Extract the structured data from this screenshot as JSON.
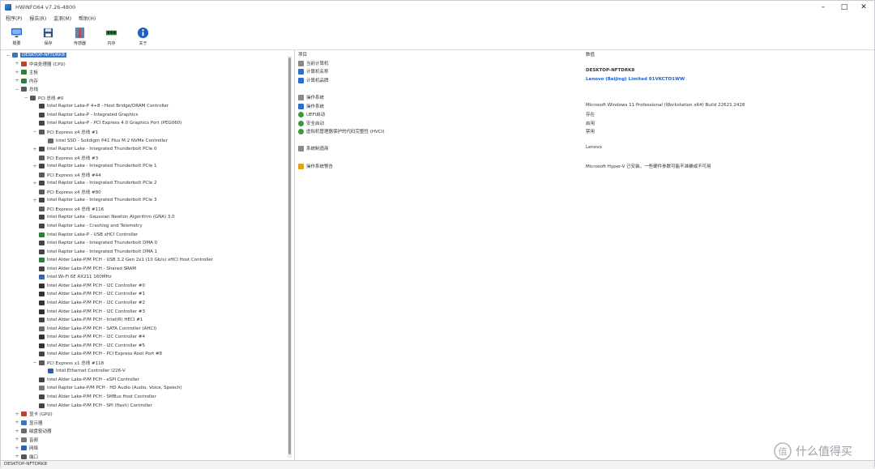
{
  "window": {
    "title": "HWiNFO64 v7.26-4800"
  },
  "menu": {
    "items": [
      "程序(P)",
      "报告(R)",
      "监测(M)",
      "帮助(H)"
    ]
  },
  "toolbar": {
    "buttons": [
      "概要",
      "保存",
      "传感器",
      "内存",
      "关于"
    ]
  },
  "tree": {
    "items": [
      {
        "label": "DESKTOP-NFTDRK8",
        "depth": 0,
        "exp": "−",
        "icon": "computer",
        "selected": true
      },
      {
        "label": "中央处理器 (CPU)",
        "depth": 1,
        "exp": "+",
        "icon": "cpu"
      },
      {
        "label": "主板",
        "depth": 1,
        "exp": "+",
        "icon": "board"
      },
      {
        "label": "内存",
        "depth": 1,
        "exp": "+",
        "icon": "memory"
      },
      {
        "label": "总线",
        "depth": 1,
        "exp": "−",
        "icon": "bus"
      },
      {
        "label": "PCI 总线 #0",
        "depth": 2,
        "exp": "−",
        "icon": "bus"
      },
      {
        "label": "Intel Raptor Lake-P 4+8 - Host Bridge/DRAM Controller",
        "depth": 3,
        "exp": "",
        "icon": "chip"
      },
      {
        "label": "Intel Raptor Lake-P - Integrated Graphics",
        "depth": 3,
        "exp": "",
        "icon": "chip"
      },
      {
        "label": "Intel Raptor Lake-P - PCI Express 4.0 Graphics Port (PEG060)",
        "depth": 3,
        "exp": "",
        "icon": "chip"
      },
      {
        "label": "PCI Express x4 总线 #1",
        "depth": 3,
        "exp": "−",
        "icon": "bus"
      },
      {
        "label": "Intel SSD - Solidigm P41 Plus M.2 NVMe Controller",
        "depth": 4,
        "exp": "",
        "icon": "disk"
      },
      {
        "label": "Intel Raptor Lake - Integrated Thunderbolt PCIe 0",
        "depth": 3,
        "exp": "+",
        "icon": "chip"
      },
      {
        "label": "PCI Express x4 总线 #3",
        "depth": 3,
        "exp": "",
        "icon": "bus"
      },
      {
        "label": "Intel Raptor Lake - Integrated Thunderbolt PCIe 1",
        "depth": 3,
        "exp": "+",
        "icon": "chip"
      },
      {
        "label": "PCI Express x4 总线 #44",
        "depth": 3,
        "exp": "",
        "icon": "bus"
      },
      {
        "label": "Intel Raptor Lake - Integrated Thunderbolt PCIe 2",
        "depth": 3,
        "exp": "+",
        "icon": "chip"
      },
      {
        "label": "PCI Express x4 总线 #80",
        "depth": 3,
        "exp": "",
        "icon": "bus"
      },
      {
        "label": "Intel Raptor Lake - Integrated Thunderbolt PCIe 3",
        "depth": 3,
        "exp": "+",
        "icon": "chip"
      },
      {
        "label": "PCI Express x4 总线 #116",
        "depth": 3,
        "exp": "",
        "icon": "bus"
      },
      {
        "label": "Intel Raptor Lake - Gaussian Newton Algorithm (GNA) 3.0",
        "depth": 3,
        "exp": "",
        "icon": "chip"
      },
      {
        "label": "Intel Raptor Lake - Crashlog and Telemetry",
        "depth": 3,
        "exp": "",
        "icon": "chip"
      },
      {
        "label": "Intel Raptor Lake-P - USB xHCI Controller",
        "depth": 3,
        "exp": "",
        "icon": "usb"
      },
      {
        "label": "Intel Raptor Lake - Integrated Thunderbolt DMA 0",
        "depth": 3,
        "exp": "",
        "icon": "chip"
      },
      {
        "label": "Intel Raptor Lake - Integrated Thunderbolt DMA 1",
        "depth": 3,
        "exp": "",
        "icon": "chip"
      },
      {
        "label": "Intel Alder Lake-P/M PCH - USB 3.2 Gen 2x1 (10 Gb/s) xHCI Host Controller",
        "depth": 3,
        "exp": "",
        "icon": "usb"
      },
      {
        "label": "Intel Alder Lake-P/M PCH - Shared SRAM",
        "depth": 3,
        "exp": "",
        "icon": "chip"
      },
      {
        "label": "Intel Wi-Fi 6E AX211 160MHz",
        "depth": 3,
        "exp": "",
        "icon": "wifi"
      },
      {
        "label": "Intel Alder Lake-P/M PCH - I2C Controller #0",
        "depth": 3,
        "exp": "",
        "icon": "serial"
      },
      {
        "label": "Intel Alder Lake-P/M PCH - I2C Controller #1",
        "depth": 3,
        "exp": "",
        "icon": "serial"
      },
      {
        "label": "Intel Alder Lake-P/M PCH - I2C Controller #2",
        "depth": 3,
        "exp": "",
        "icon": "serial"
      },
      {
        "label": "Intel Alder Lake-P/M PCH - I2C Controller #3",
        "depth": 3,
        "exp": "",
        "icon": "serial"
      },
      {
        "label": "Intel Alder Lake-P/M PCH - Intel(R) HECI #1",
        "depth": 3,
        "exp": "",
        "icon": "chip"
      },
      {
        "label": "Intel Alder Lake-P/M PCH - SATA Controller (AHCI)",
        "depth": 3,
        "exp": "",
        "icon": "disk"
      },
      {
        "label": "Intel Alder Lake-P/M PCH - I2C Controller #4",
        "depth": 3,
        "exp": "",
        "icon": "serial"
      },
      {
        "label": "Intel Alder Lake-P/M PCH - I2C Controller #5",
        "depth": 3,
        "exp": "",
        "icon": "serial"
      },
      {
        "label": "Intel Alder Lake-P/M PCH - PCI Express Root Port #8",
        "depth": 3,
        "exp": "",
        "icon": "chip"
      },
      {
        "label": "PCI Express x1 总线 #118",
        "depth": 3,
        "exp": "−",
        "icon": "bus"
      },
      {
        "label": "Intel Ethernet Controller I226-V",
        "depth": 4,
        "exp": "",
        "icon": "net"
      },
      {
        "label": "Intel Alder Lake-P/M PCH - eSPI Controller",
        "depth": 3,
        "exp": "",
        "icon": "chip"
      },
      {
        "label": "Intel Raptor Lake-P/M PCH - HD Audio (Audio, Voice, Speech)",
        "depth": 3,
        "exp": "",
        "icon": "audio"
      },
      {
        "label": "Intel Alder Lake-P/M PCH - SMBus Host Controller",
        "depth": 3,
        "exp": "",
        "icon": "chip"
      },
      {
        "label": "Intel Alder Lake-P/M PCH - SPI (flash) Controller",
        "depth": 3,
        "exp": "",
        "icon": "chip"
      },
      {
        "label": "显卡 (GPU)",
        "depth": 1,
        "exp": "+",
        "icon": "gpu"
      },
      {
        "label": "显示器",
        "depth": 1,
        "exp": "+",
        "icon": "monitor"
      },
      {
        "label": "磁盘驱动器",
        "depth": 1,
        "exp": "+",
        "icon": "disk"
      },
      {
        "label": "音频",
        "depth": 1,
        "exp": "+",
        "icon": "audio"
      },
      {
        "label": "网络",
        "depth": 1,
        "exp": "+",
        "icon": "net"
      },
      {
        "label": "端口",
        "depth": 1,
        "exp": "+",
        "icon": "port"
      }
    ]
  },
  "details": {
    "header_left": "项目",
    "header_right": "数值",
    "rows": [
      {
        "label": "当前计算机",
        "value": "",
        "icon": "pc",
        "indent": 0,
        "value_style": ""
      },
      {
        "label": "计算机名称",
        "value": "DESKTOP-NFTDRK8",
        "icon": "blue",
        "indent": 1,
        "value_style": "bold"
      },
      {
        "label": "计算机品牌",
        "value": "Lenovo (Beijing) Limited 91VKCTO1WW",
        "icon": "blue",
        "indent": 1,
        "value_style": "link"
      },
      {
        "label": "操作系统",
        "value": "",
        "icon": "pc",
        "indent": 0,
        "value_style": ""
      },
      {
        "label": "操作系统",
        "value": "Microsoft Windows 11 Professional (Workstation x64) Build 22621.2428",
        "icon": "blue",
        "indent": 1,
        "value_style": ""
      },
      {
        "label": "UEFI启动",
        "value": "存在",
        "icon": "green",
        "indent": 1,
        "value_style": ""
      },
      {
        "label": "安全启动",
        "value": "启用",
        "icon": "green",
        "indent": 1,
        "value_style": ""
      },
      {
        "label": "虚拟机管理器保护的代码完整性 (HVCI)",
        "value": "禁用",
        "icon": "green",
        "indent": 1,
        "value_style": ""
      },
      {
        "label": "系统制造商",
        "value": "Lenovo",
        "icon": "pc",
        "indent": 0,
        "value_style": ""
      },
      {
        "label": "操作系统警告",
        "value": "Microsoft Hyper-V 已安装，一些硬件参数可能不准确或不可用",
        "icon": "warn",
        "indent": 0,
        "value_style": ""
      }
    ]
  },
  "status": {
    "text": "DESKTOP-NFTDRK8"
  },
  "watermark": {
    "text": "什么值得买"
  }
}
